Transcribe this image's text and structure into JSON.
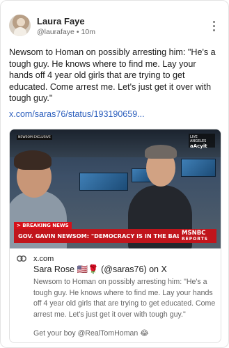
{
  "post": {
    "author_name": "Laura Faye",
    "handle": "@laurafaye",
    "separator": "•",
    "time": "10m",
    "menu_icon": "kebab-menu-icon",
    "text": "Newsom to Homan on possibly arresting him: \"He's a tough guy. He knows where to find me. Lay your hands off 4 year old girls that are trying to get educated. Come arrest me. Let's just get it over with tough guy.\"",
    "link_text": "x.com/saras76/status/193190659..."
  },
  "card": {
    "video": {
      "corner_tag": "NEWSOM EXCLUSIVE",
      "bug_line1": "LIVE ANGELES",
      "bug_line2": "aAcyit",
      "breaking_label": "> BREAKING NEWS",
      "chyron": "GOV. GAVIN NEWSOM: \"DEMOCRACY IS IN THE BALANCE\"",
      "network_logo": "MSNBC",
      "network_sub": "REPORTS"
    },
    "link_icon": "link-icon",
    "domain": "x.com",
    "title": "Sara Rose 🇺🇸🌹 (@saras76) on X",
    "description": "Newsom to Homan on possibly arresting him: \"He's a tough guy.  He knows where to find me. Lay your hands off 4 year old girls that are trying to get educated. Come  arrest me. Let's just get it over with tough guy.\"",
    "footer": "Get your boy @RealTomHoman 😂"
  },
  "colors": {
    "link": "#2b5ebd",
    "chyron_red": "#c1151c",
    "breaking_red": "#d6111a"
  }
}
